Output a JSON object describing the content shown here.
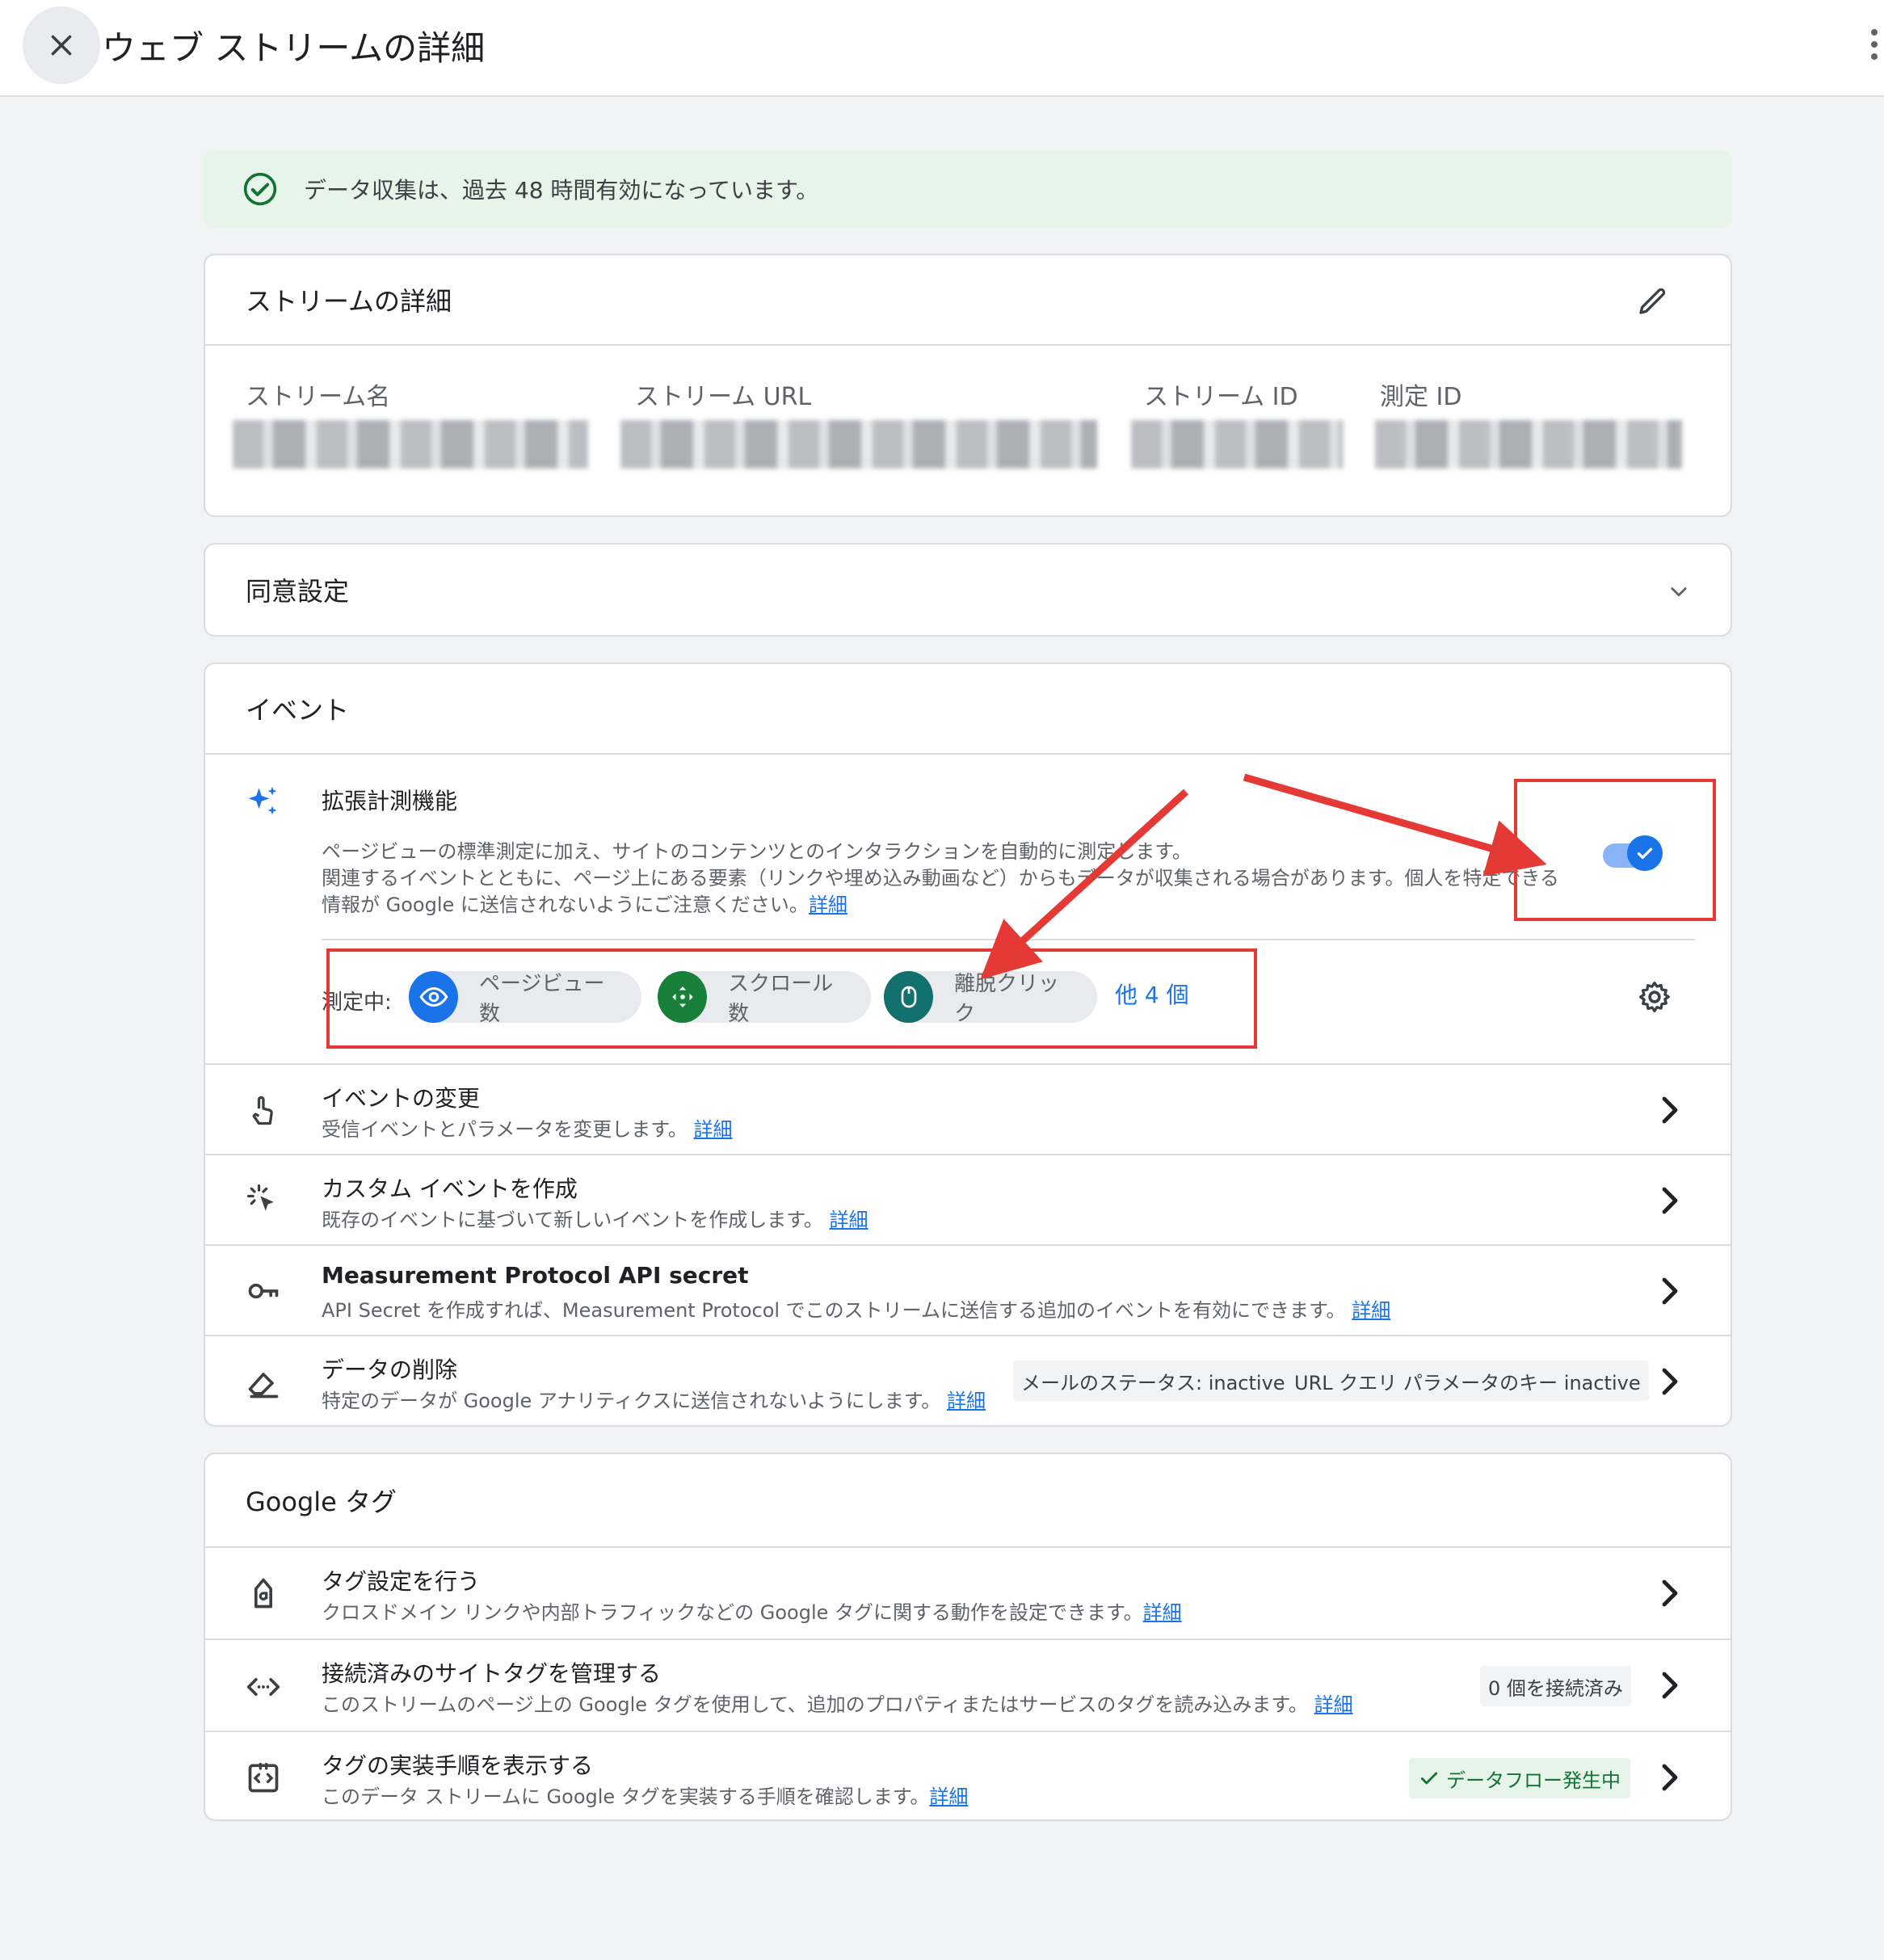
{
  "header": {
    "close_icon": "close-icon",
    "title": "ウェブ ストリームの詳細",
    "more_icon": "more-vert-icon"
  },
  "banner": {
    "icon": "check-circle-icon",
    "text": "データ収集は、過去 48 時間有効になっています。",
    "color": "#e6f4ea"
  },
  "stream_details": {
    "title": "ストリームの詳細",
    "edit_icon": "edit-icon",
    "labels": [
      "ストリーム名",
      "ストリーム URL",
      "ストリーム ID",
      "測定 ID"
    ]
  },
  "consent": {
    "title": "同意設定",
    "expand_icon": "chevron-down-icon"
  },
  "events": {
    "title": "イベント",
    "enhanced": {
      "title": "拡張計測機能",
      "desc_line1": "ページビューの標準測定に加え、サイトのコンテンツとのインタラクションを自動的に測定します。",
      "desc_line2": "関連するイベントとともに、ページ上にある要素（リンクや埋め込み動画など）からもデータが収集される場合があります。個人を特定できる",
      "desc_line3": "情報が Google に送信されないようにご注意ください。",
      "link": "詳細",
      "toggle_on": true,
      "measuring_label": "測定中:",
      "chips": [
        "ページビュー数",
        "スクロール数",
        "離脱クリック"
      ],
      "more": "他 4 個",
      "settings_icon": "gear-icon"
    },
    "rows": [
      {
        "title": "イベントの変更",
        "desc": "受信イベントとパラメータを変更します。",
        "link": "詳細",
        "icon": "touch-icon"
      },
      {
        "title": "カスタム イベントを作成",
        "desc": "既存のイベントに基づいて新しいイベントを作成します。",
        "link": "詳細",
        "icon": "click-sparkle-icon"
      },
      {
        "title": "Measurement Protocol API secret",
        "desc": "API Secret を作成すれば、Measurement Protocol でこのストリームに送信する追加のイベントを有効にできます。",
        "link": "詳細",
        "icon": "key-icon"
      },
      {
        "title": "データの削除",
        "desc": "特定のデータが Google アナリティクスに送信されないようにします。",
        "link": "詳細",
        "icon": "eraser-icon",
        "tag1": "メールのステータス: inactive",
        "tag2": "URL クエリ パラメータのキー inactive"
      }
    ]
  },
  "google_tag": {
    "title": "Google タグ",
    "rows": [
      {
        "title": "タグ設定を行う",
        "desc": "クロスドメイン リンクや内部トラフィックなどの Google タグに関する動作を設定できます。",
        "link": "詳細",
        "icon": "tag-icon"
      },
      {
        "title": "接続済みのサイトタグを管理する",
        "desc": "このストリームのページ上の Google タグを使用して、追加のプロパティまたはサービスのタグを読み込みます。",
        "link": "詳細",
        "icon": "code-icon",
        "tag": "0 個を接続済み"
      },
      {
        "title": "タグの実装手順を表示する",
        "desc": "このデータ ストリームに Google タグを実装する手順を確認します。",
        "link": "詳細",
        "icon": "code-box-icon",
        "status": "データフロー発生中"
      }
    ]
  },
  "colors": {
    "accent": "#1a73e8",
    "annotation": "#e53935",
    "success": "#137333"
  }
}
